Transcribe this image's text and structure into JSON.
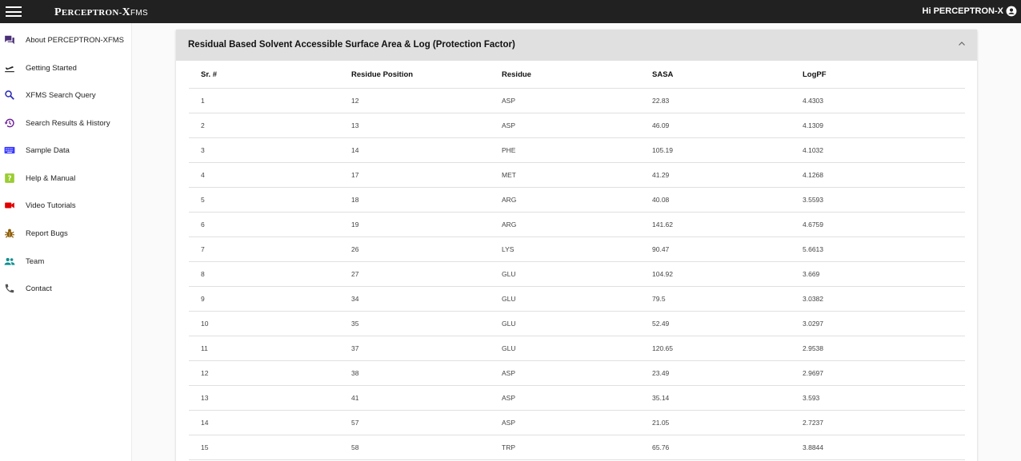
{
  "header": {
    "logo": {
      "initial": "P",
      "rest": "ERCEPTRON",
      "sep": "-",
      "x": "X",
      "sub": "FMS"
    },
    "greeting": "Hi PERCEPTRON-X"
  },
  "sidebar": {
    "items": [
      {
        "label": "About PERCEPTRON-XFMS",
        "icon": "forum-icon",
        "color": "#4a2f78"
      },
      {
        "label": "Getting Started",
        "icon": "flight-takeoff-icon",
        "color": "#222222"
      },
      {
        "label": "XFMS Search Query",
        "icon": "search-icon",
        "color": "#2a2ab8"
      },
      {
        "label": "Search Results & History",
        "icon": "history-icon",
        "color": "#6a1b9a"
      },
      {
        "label": "Sample Data",
        "icon": "keyboard-icon",
        "color": "#3a3aff"
      },
      {
        "label": "Help & Manual",
        "icon": "help-icon",
        "color": "#9acd32"
      },
      {
        "label": "Video Tutorials",
        "icon": "videocam-icon",
        "color": "#e00000"
      },
      {
        "label": "Report Bugs",
        "icon": "bug-icon",
        "color": "#8b5a00"
      },
      {
        "label": "Team",
        "icon": "people-icon",
        "color": "#0f8f8f"
      },
      {
        "label": "Contact",
        "icon": "phone-icon",
        "color": "#555555"
      }
    ]
  },
  "panel": {
    "title": "Residual Based Solvent Accessible Surface Area & Log (Protection Factor)",
    "columns": [
      "Sr. #",
      "Residue Position",
      "Residue",
      "SASA",
      "LogPF"
    ],
    "rows": [
      [
        "1",
        "12",
        "ASP",
        "22.83",
        "4.4303"
      ],
      [
        "2",
        "13",
        "ASP",
        "46.09",
        "4.1309"
      ],
      [
        "3",
        "14",
        "PHE",
        "105.19",
        "4.1032"
      ],
      [
        "4",
        "17",
        "MET",
        "41.29",
        "4.1268"
      ],
      [
        "5",
        "18",
        "ARG",
        "40.08",
        "3.5593"
      ],
      [
        "6",
        "19",
        "ARG",
        "141.62",
        "4.6759"
      ],
      [
        "7",
        "26",
        "LYS",
        "90.47",
        "5.6613"
      ],
      [
        "8",
        "27",
        "GLU",
        "104.92",
        "3.669"
      ],
      [
        "9",
        "34",
        "GLU",
        "79.5",
        "3.0382"
      ],
      [
        "10",
        "35",
        "GLU",
        "52.49",
        "3.0297"
      ],
      [
        "11",
        "37",
        "GLU",
        "120.65",
        "2.9538"
      ],
      [
        "12",
        "38",
        "ASP",
        "23.49",
        "2.9697"
      ],
      [
        "13",
        "41",
        "ASP",
        "35.14",
        "3.593"
      ],
      [
        "14",
        "57",
        "ASP",
        "21.05",
        "2.7237"
      ],
      [
        "15",
        "58",
        "TRP",
        "65.76",
        "3.8844"
      ]
    ]
  }
}
